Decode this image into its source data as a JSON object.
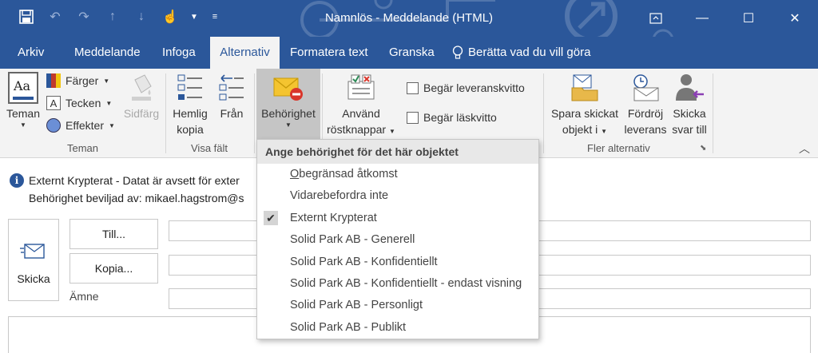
{
  "window": {
    "title": "Namnlös  -  Meddelande (HTML)"
  },
  "tabs": [
    {
      "label": "Arkiv"
    },
    {
      "label": "Meddelande"
    },
    {
      "label": "Infoga"
    },
    {
      "label": "Alternativ"
    },
    {
      "label": "Formatera text"
    },
    {
      "label": "Granska"
    },
    {
      "label": "Berätta vad du vill göra"
    }
  ],
  "ribbon": {
    "teman": {
      "themes_label": "Teman",
      "colors_label": "Färger",
      "fonts_label": "Tecken",
      "effects_label": "Effekter",
      "pagecolor_label": "Sidfärg",
      "group_label": "Teman"
    },
    "visa_falt": {
      "bcc_line1": "Hemlig",
      "bcc_line2": "kopia",
      "from_label": "Från",
      "group_label": "Visa fält"
    },
    "permission": {
      "label": "Behörighet"
    },
    "tracking": {
      "voting_line1": "Använd",
      "voting_line2": "röstknappar",
      "delivery_receipt": "Begär leveranskvitto",
      "read_receipt": "Begär läskvitto"
    },
    "more": {
      "save_line1": "Spara skickat",
      "save_line2": "objekt i",
      "delay_line1": "Fördröj",
      "delay_line2": "leverans",
      "reply_line1": "Skicka",
      "reply_line2": "svar till",
      "group_label": "Fler alternativ"
    }
  },
  "info": {
    "line1": "Externt Krypterat - Datat är avsett för exter",
    "line2": "Behörighet beviljad av: mikael.hagstrom@s"
  },
  "compose": {
    "send_label": "Skicka",
    "to_label": "Till...",
    "cc_label": "Kopia...",
    "subject_label": "Ämne"
  },
  "permission_menu": {
    "header": "Ange behörighet för det här objektet",
    "items": [
      {
        "label_first": "O",
        "label_rest": "begränsad åtkomst",
        "checked": false
      },
      {
        "label": "Vidarebefordra inte",
        "checked": false
      },
      {
        "label": "Externt Krypterat",
        "checked": true
      },
      {
        "label": "Solid Park AB - Generell",
        "checked": false
      },
      {
        "label": "Solid Park AB - Konfidentiellt",
        "checked": false
      },
      {
        "label": "Solid Park AB - Konfidentiellt - endast visning",
        "checked": false
      },
      {
        "label": "Solid Park AB - Personligt",
        "checked": false
      },
      {
        "label": "Solid Park AB - Publikt",
        "checked": false
      }
    ]
  },
  "colors": {
    "brand": "#2b579a",
    "ribbon_bg": "#f3f3f3"
  }
}
